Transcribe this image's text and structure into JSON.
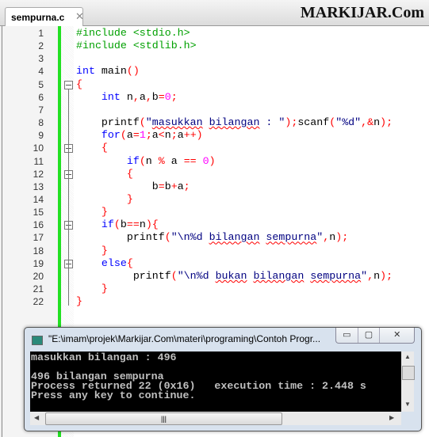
{
  "tab": {
    "filename": "sempurna.c",
    "close": "✕"
  },
  "brand": "MARKIJAR.Com",
  "lines": [
    {
      "n": "1",
      "tokens": [
        [
          "pp",
          "#include <stdio.h>"
        ]
      ]
    },
    {
      "n": "2",
      "tokens": [
        [
          "pp",
          "#include <stdlib.h>"
        ]
      ]
    },
    {
      "n": "3",
      "tokens": []
    },
    {
      "n": "4",
      "tokens": [
        [
          "kw",
          "int"
        ],
        [
          "id",
          " main"
        ],
        [
          "op",
          "()"
        ]
      ]
    },
    {
      "n": "5",
      "fold": true,
      "tokens": [
        [
          "op",
          "{"
        ]
      ]
    },
    {
      "n": "6",
      "tokens": [
        [
          "id",
          "    "
        ],
        [
          "kw",
          "int"
        ],
        [
          "id",
          " n"
        ],
        [
          "op",
          ","
        ],
        [
          "id",
          "a"
        ],
        [
          "op",
          ","
        ],
        [
          "id",
          "b"
        ],
        [
          "op",
          "="
        ],
        [
          "num",
          "0"
        ],
        [
          "op",
          ";"
        ]
      ]
    },
    {
      "n": "7",
      "tokens": []
    },
    {
      "n": "8",
      "tokens": [
        [
          "id",
          "    printf"
        ],
        [
          "op",
          "("
        ],
        [
          "str",
          "\""
        ],
        [
          "strsq",
          "masukkan"
        ],
        [
          "str",
          " "
        ],
        [
          "strsq",
          "bilangan"
        ],
        [
          "str",
          " : \""
        ],
        [
          "op",
          ");"
        ],
        [
          "id",
          "scanf"
        ],
        [
          "op",
          "("
        ],
        [
          "str",
          "\"%d\""
        ],
        [
          "op",
          ",&"
        ],
        [
          "id",
          "n"
        ],
        [
          "op",
          ");"
        ]
      ]
    },
    {
      "n": "9",
      "tokens": [
        [
          "id",
          "    "
        ],
        [
          "kw",
          "for"
        ],
        [
          "op",
          "("
        ],
        [
          "id",
          "a"
        ],
        [
          "op",
          "="
        ],
        [
          "num",
          "1"
        ],
        [
          "op",
          ";"
        ],
        [
          "id",
          "a"
        ],
        [
          "op",
          "<"
        ],
        [
          "id",
          "n"
        ],
        [
          "op",
          ";"
        ],
        [
          "id",
          "a"
        ],
        [
          "op",
          "++)"
        ]
      ]
    },
    {
      "n": "10",
      "fold": true,
      "tokens": [
        [
          "op",
          "    {"
        ]
      ]
    },
    {
      "n": "11",
      "tokens": [
        [
          "id",
          "        "
        ],
        [
          "kw",
          "if"
        ],
        [
          "op",
          "("
        ],
        [
          "id",
          "n "
        ],
        [
          "op",
          "%"
        ],
        [
          "id",
          " a "
        ],
        [
          "op",
          "=="
        ],
        [
          "id",
          " "
        ],
        [
          "num",
          "0"
        ],
        [
          "op",
          ")"
        ]
      ]
    },
    {
      "n": "12",
      "fold": true,
      "tokens": [
        [
          "op",
          "        {"
        ]
      ]
    },
    {
      "n": "13",
      "tokens": [
        [
          "id",
          "            b"
        ],
        [
          "op",
          "="
        ],
        [
          "id",
          "b"
        ],
        [
          "op",
          "+"
        ],
        [
          "id",
          "a"
        ],
        [
          "op",
          ";"
        ]
      ]
    },
    {
      "n": "14",
      "tokens": [
        [
          "op",
          "        }"
        ]
      ]
    },
    {
      "n": "15",
      "tokens": [
        [
          "op",
          "    }"
        ]
      ]
    },
    {
      "n": "16",
      "fold": true,
      "tokens": [
        [
          "id",
          "    "
        ],
        [
          "kw",
          "if"
        ],
        [
          "op",
          "("
        ],
        [
          "id",
          "b"
        ],
        [
          "op",
          "=="
        ],
        [
          "id",
          "n"
        ],
        [
          "op",
          "){"
        ]
      ]
    },
    {
      "n": "17",
      "tokens": [
        [
          "id",
          "        printf"
        ],
        [
          "op",
          "("
        ],
        [
          "str",
          "\"\\n%d "
        ],
        [
          "strsq",
          "bilangan"
        ],
        [
          "str",
          " "
        ],
        [
          "strsq",
          "sempurna"
        ],
        [
          "str",
          "\""
        ],
        [
          "op",
          ","
        ],
        [
          "id",
          "n"
        ],
        [
          "op",
          ");"
        ]
      ]
    },
    {
      "n": "18",
      "tokens": [
        [
          "op",
          "    }"
        ]
      ]
    },
    {
      "n": "19",
      "fold": true,
      "tokens": [
        [
          "id",
          "    "
        ],
        [
          "kw",
          "else"
        ],
        [
          "op",
          "{"
        ]
      ]
    },
    {
      "n": "20",
      "tokens": [
        [
          "id",
          "         printf"
        ],
        [
          "op",
          "("
        ],
        [
          "str",
          "\"\\n%d "
        ],
        [
          "strsq",
          "bukan"
        ],
        [
          "str",
          " "
        ],
        [
          "strsq",
          "bilangan"
        ],
        [
          "str",
          " "
        ],
        [
          "strsq",
          "sempurna"
        ],
        [
          "str",
          "\""
        ],
        [
          "op",
          ","
        ],
        [
          "id",
          "n"
        ],
        [
          "op",
          ");"
        ]
      ]
    },
    {
      "n": "21",
      "tokens": [
        [
          "op",
          "    }"
        ]
      ]
    },
    {
      "n": "22",
      "tokens": [
        [
          "op",
          "}"
        ]
      ]
    }
  ],
  "console": {
    "title": "\"E:\\imam\\projek\\Markijar.Com\\materi\\programing\\Contoh Progr...",
    "buttons": [
      "▭",
      "▢",
      "✕"
    ],
    "output": "masukkan bilangan : 496\n\n496 bilangan sempurna\nProcess returned 22 (0x16)   execution time : 2.448 s\nPress any key to continue."
  },
  "colors": {
    "change_bar": "#22e022",
    "keyword": "#0000ff",
    "preprocessor": "#00a000",
    "operator": "#ff0000",
    "number": "#ff00ff",
    "string": "#000080"
  }
}
